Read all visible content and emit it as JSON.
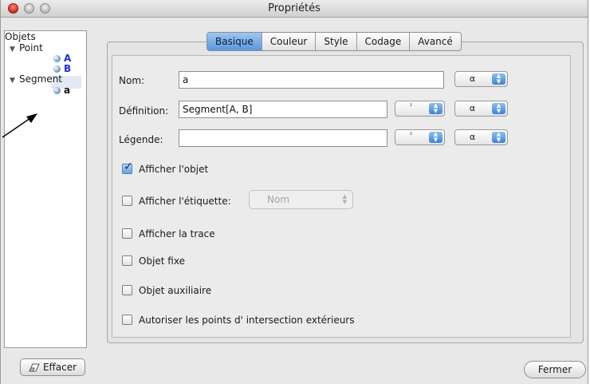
{
  "window": {
    "title": "Propriétés"
  },
  "tree": {
    "root": "Objets",
    "groups": [
      {
        "label": "Point",
        "items": [
          "A",
          "B"
        ]
      },
      {
        "label": "Segment",
        "items": [
          "a"
        ]
      }
    ]
  },
  "tabs": [
    {
      "label": "Basique",
      "active": true
    },
    {
      "label": "Couleur",
      "active": false
    },
    {
      "label": "Style",
      "active": false
    },
    {
      "label": "Codage",
      "active": false
    },
    {
      "label": "Avancé",
      "active": false
    }
  ],
  "form": {
    "name_label": "Nom:",
    "name_value": "a",
    "definition_label": "Définition:",
    "definition_value": "Segment[A, B]",
    "caption_label": "Légende:",
    "caption_value": "",
    "alpha_symbol": "α",
    "superscript_symbol": "²"
  },
  "checkboxes": [
    {
      "label": "Afficher l'objet",
      "checked": true
    },
    {
      "label": "Afficher l'étiquette:",
      "checked": false
    },
    {
      "label": "Afficher la trace",
      "checked": false
    },
    {
      "label": "Objet fixe",
      "checked": false
    },
    {
      "label": "Objet auxiliaire",
      "checked": false
    },
    {
      "label": "Autoriser les points d' intersection extérieurs",
      "checked": false
    }
  ],
  "label_mode": {
    "value": "Nom"
  },
  "buttons": {
    "clear": "Effacer",
    "close": "Fermer"
  },
  "colors": {
    "accent": "#5a96dc",
    "point_label": "#1a2fd6"
  }
}
